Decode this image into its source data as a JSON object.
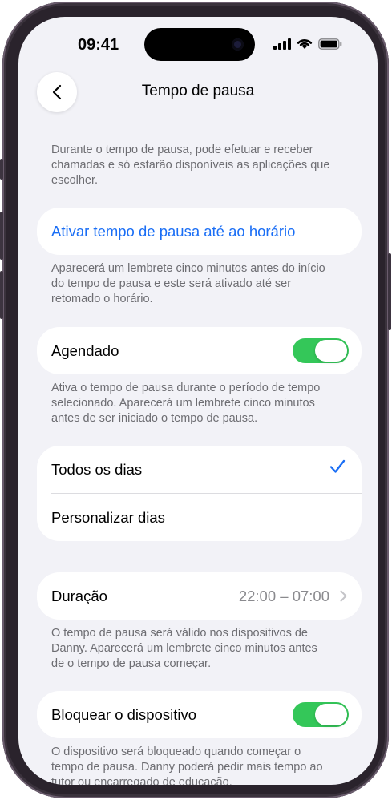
{
  "status_bar": {
    "time": "09:41"
  },
  "nav": {
    "title": "Tempo de pausa"
  },
  "intro_note": "Durante o tempo de pausa, pode efetuar e receber chamadas e só estarão disponíveis as aplicações que escolher.",
  "activate": {
    "label": "Ativar tempo de pausa até ao horário",
    "note": "Aparecerá um lembrete cinco minutos antes do início do tempo de pausa e este será ativado até ser retomado o horário."
  },
  "scheduled": {
    "label": "Agendado",
    "enabled": true,
    "note": "Ativa o tempo de pausa durante o período de tempo selecionado. Aparecerá um lembrete cinco minutos antes de ser iniciado o tempo de pausa."
  },
  "days": {
    "options": [
      "Todos os dias",
      "Personalizar dias"
    ],
    "selected": "Todos os dias"
  },
  "duration": {
    "label": "Duração",
    "value": "22:00 – 07:00",
    "note": "O tempo de pausa será válido nos dispositivos de Danny. Aparecerá um lembrete cinco minutos antes de o tempo de pausa começar."
  },
  "block": {
    "label": "Bloquear o dispositivo",
    "enabled": true,
    "note": "O dispositivo será bloqueado quando começar o tempo de pausa. Danny poderá pedir mais tempo ao tutor ou encarregado de educação."
  },
  "colors": {
    "accent": "#1a6ef5",
    "toggle_on": "#34c759",
    "background": "#f2f2f7"
  },
  "icons": [
    "signal-icon",
    "wifi-icon",
    "battery-icon",
    "back-chevron-icon",
    "checkmark-icon",
    "chevron-right-icon"
  ]
}
